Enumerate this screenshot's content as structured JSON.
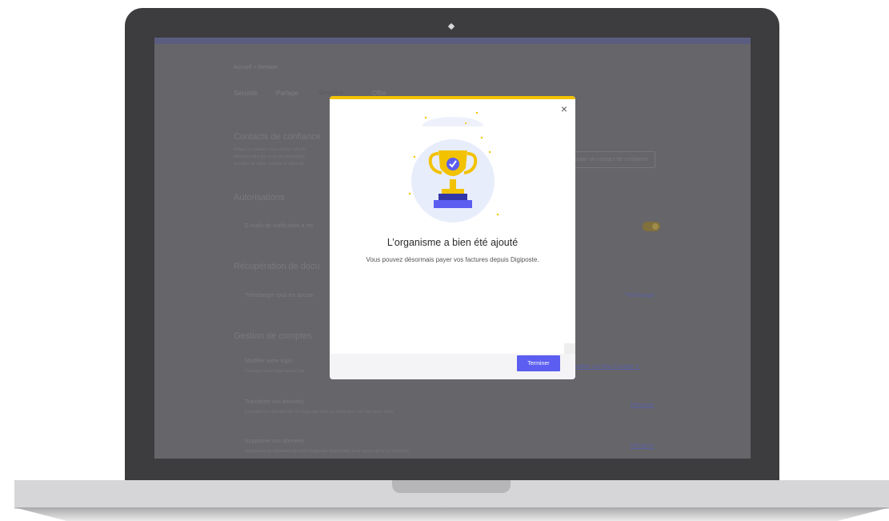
{
  "app": {
    "breadcrumb": "Accueil  >  Gestion",
    "tabs": [
      {
        "label": "Sécurité"
      },
      {
        "label": "Partage"
      },
      {
        "label": "Gestion"
      },
      {
        "label": "Offre"
      }
    ],
    "sections": {
      "trusted_contacts": {
        "title": "Contacts de confiance",
        "desc_lines": [
          "Grâce ce contact vous utiliser vos do",
          "informés lors qui vous ont et protégé",
          "accéder de votre compte et votre do"
        ],
        "add_button": "Ajouter un contact de confiance"
      },
      "authorizations": {
        "title": "Autorisations",
        "row_label": "E-mails de notification à réc"
      },
      "document_retrieval": {
        "title": "Récupération de docu",
        "row_label": "Télécharger tous les docum",
        "link": "Télécharger"
      },
      "account_management": {
        "title": "Gestion de comptes",
        "rows": [
          {
            "title": "Modifier votre login",
            "desc": "Changez votre login actuel par",
            "link": "Modifier sur Mon Compte ↗"
          },
          {
            "title": "Transférer vos données",
            "desc": "Exportez les données de ce Digiposte vers un autre pour nos fast pour cette",
            "link": "Démarrer"
          },
          {
            "title": "Supprimer vos données",
            "desc": "Supprimez les données de votre Digiposte disponibles pour accès qui à ce consentir",
            "link": "Démarrer"
          }
        ]
      }
    }
  },
  "modal": {
    "close_icon": "×",
    "title": "L’organisme a bien été ajouté",
    "message": "Vous pouvez désormais payer vos factures depuis Digiposte.",
    "primary_button": "Terminer"
  },
  "colors": {
    "accent": "#5b5ef0",
    "modal_top_bar": "#f2c200",
    "trophy": "#f2c200"
  }
}
